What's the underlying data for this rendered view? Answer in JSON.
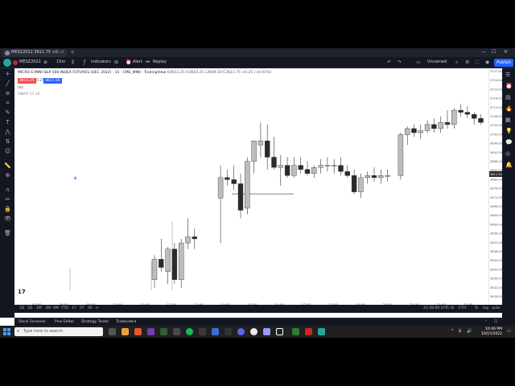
{
  "tab": {
    "title": "MESZ2022",
    "price": "3611.75",
    "change": "+0..."
  },
  "toolbar": {
    "symbol": "MESZ2022",
    "interval": "15m",
    "indicators": "Indicators",
    "alert": "Alert",
    "replay": "Replay",
    "layout": "Unnamed",
    "publish": "Publish"
  },
  "legend": {
    "title": "MICRO E-MINI S&P 500 INDEX FUTURES (DEC 2022) · 15 · CME_MINI · TradingView",
    "ohlc": "O3611.25 H3610.25 L3609.50 C3611.75 +0.25 (+0.01%)",
    "sell_price": "3611.25",
    "spread": "0.25",
    "buy_price": "3611.50",
    "vol": "Vol",
    "ind": "VWAP 15 10"
  },
  "price_labels": [
    "3727.00",
    "3724.00",
    "3720.00",
    "3716.00",
    "3712.00",
    "3708.00",
    "3704.00",
    "3700.00",
    "3696.00",
    "3692.00",
    "3688.00",
    "3684.00",
    "3680.00",
    "3676.00",
    "3672.00",
    "3668.00",
    "3664.00",
    "3660.00",
    "3656.00",
    "3652.00",
    "3648.00",
    "3644.00",
    "3640.00",
    "3636.00",
    "3632.00",
    "3628.00"
  ],
  "time_labels": [
    "07:00",
    "08:00",
    "09:00",
    "10:00",
    "11:00",
    "12:00",
    "13:00",
    "14:00",
    "15:00",
    "16:00",
    "17:00",
    "18:00",
    "19:00",
    "20:00",
    "21:00",
    "22:00",
    "23:00",
    "16"
  ],
  "chart_data": {
    "type": "candlestick",
    "ylim": [
      3624,
      3728
    ],
    "candles": [
      {
        "o": 3630,
        "h": 3642,
        "l": 3626,
        "c": 3640
      },
      {
        "o": 3640,
        "h": 3650,
        "l": 3634,
        "c": 3636
      },
      {
        "o": 3634,
        "h": 3646,
        "l": 3628,
        "c": 3645
      },
      {
        "o": 3645,
        "h": 3648,
        "l": 3628,
        "c": 3630
      },
      {
        "o": 3630,
        "h": 3650,
        "l": 3626,
        "c": 3648
      },
      {
        "o": 3648,
        "h": 3660,
        "l": 3645,
        "c": 3651
      },
      {
        "o": 3651,
        "h": 3655,
        "l": 3645,
        "c": 3650
      },
      {
        "o": 3670,
        "h": 3686,
        "l": 3648,
        "c": 3680
      },
      {
        "o": 3680,
        "h": 3684,
        "l": 3676,
        "c": 3679
      },
      {
        "o": 3679,
        "h": 3686,
        "l": 3674,
        "c": 3677
      },
      {
        "o": 3677,
        "h": 3682,
        "l": 3660,
        "c": 3664
      },
      {
        "o": 3665,
        "h": 3690,
        "l": 3662,
        "c": 3688
      },
      {
        "o": 3688,
        "h": 3698,
        "l": 3682,
        "c": 3698
      },
      {
        "o": 3696,
        "h": 3707,
        "l": 3690,
        "c": 3698
      },
      {
        "o": 3698,
        "h": 3706,
        "l": 3684,
        "c": 3690
      },
      {
        "o": 3690,
        "h": 3700,
        "l": 3684,
        "c": 3685
      },
      {
        "o": 3685,
        "h": 3691,
        "l": 3676,
        "c": 3686
      },
      {
        "o": 3686,
        "h": 3690,
        "l": 3680,
        "c": 3681
      },
      {
        "o": 3681,
        "h": 3690,
        "l": 3680,
        "c": 3686
      },
      {
        "o": 3686,
        "h": 3690,
        "l": 3682,
        "c": 3684
      },
      {
        "o": 3684,
        "h": 3688,
        "l": 3681,
        "c": 3682
      },
      {
        "o": 3682,
        "h": 3686,
        "l": 3680,
        "c": 3685
      },
      {
        "o": 3685,
        "h": 3689,
        "l": 3682,
        "c": 3686
      },
      {
        "o": 3686,
        "h": 3690,
        "l": 3683,
        "c": 3686
      },
      {
        "o": 3686,
        "h": 3689,
        "l": 3682,
        "c": 3686
      },
      {
        "o": 3686,
        "h": 3690,
        "l": 3681,
        "c": 3683
      },
      {
        "o": 3683,
        "h": 3686,
        "l": 3680,
        "c": 3681
      },
      {
        "o": 3681,
        "h": 3684,
        "l": 3672,
        "c": 3673
      },
      {
        "o": 3673,
        "h": 3682,
        "l": 3670,
        "c": 3680
      },
      {
        "o": 3680,
        "h": 3683,
        "l": 3677,
        "c": 3681
      },
      {
        "o": 3681,
        "h": 3685,
        "l": 3678,
        "c": 3680
      },
      {
        "o": 3680,
        "h": 3684,
        "l": 3677,
        "c": 3681
      },
      {
        "o": 3681,
        "h": 3684,
        "l": 3678,
        "c": 3681
      },
      {
        "o": 3681,
        "h": 3702,
        "l": 3679,
        "c": 3701
      },
      {
        "o": 3701,
        "h": 3705,
        "l": 3696,
        "c": 3704
      },
      {
        "o": 3704,
        "h": 3706,
        "l": 3700,
        "c": 3702
      },
      {
        "o": 3702,
        "h": 3706,
        "l": 3699,
        "c": 3703
      },
      {
        "o": 3703,
        "h": 3708,
        "l": 3702,
        "c": 3706
      },
      {
        "o": 3706,
        "h": 3709,
        "l": 3702,
        "c": 3704
      },
      {
        "o": 3704,
        "h": 3710,
        "l": 3702,
        "c": 3707
      },
      {
        "o": 3707,
        "h": 3713,
        "l": 3704,
        "c": 3706
      },
      {
        "o": 3706,
        "h": 3714,
        "l": 3704,
        "c": 3713
      },
      {
        "o": 3713,
        "h": 3716,
        "l": 3710,
        "c": 3712
      },
      {
        "o": 3712,
        "h": 3715,
        "l": 3709,
        "c": 3711
      },
      {
        "o": 3711,
        "h": 3712,
        "l": 3706,
        "c": 3709
      },
      {
        "o": 3709,
        "h": 3711,
        "l": 3706,
        "c": 3707
      }
    ],
    "colors": {
      "up": "#bdbdbd",
      "down": "#2b2b2b"
    }
  },
  "bottombar": {
    "ranges": [
      "1D",
      "5D",
      "1M",
      "3M",
      "6M",
      "YTD",
      "1Y",
      "5Y",
      "All"
    ],
    "clock": "22:48:00 (UTC-4)",
    "session": "ETH",
    "pct": "%",
    "log": "log",
    "auto": "auto"
  },
  "panels": [
    "Stock Screener",
    "Pine Editor",
    "Strategy Tester",
    "Tradovate"
  ],
  "taskbar": {
    "search_placeholder": "Type here to search",
    "time": "10:46 PM",
    "date": "10/15/2022"
  }
}
